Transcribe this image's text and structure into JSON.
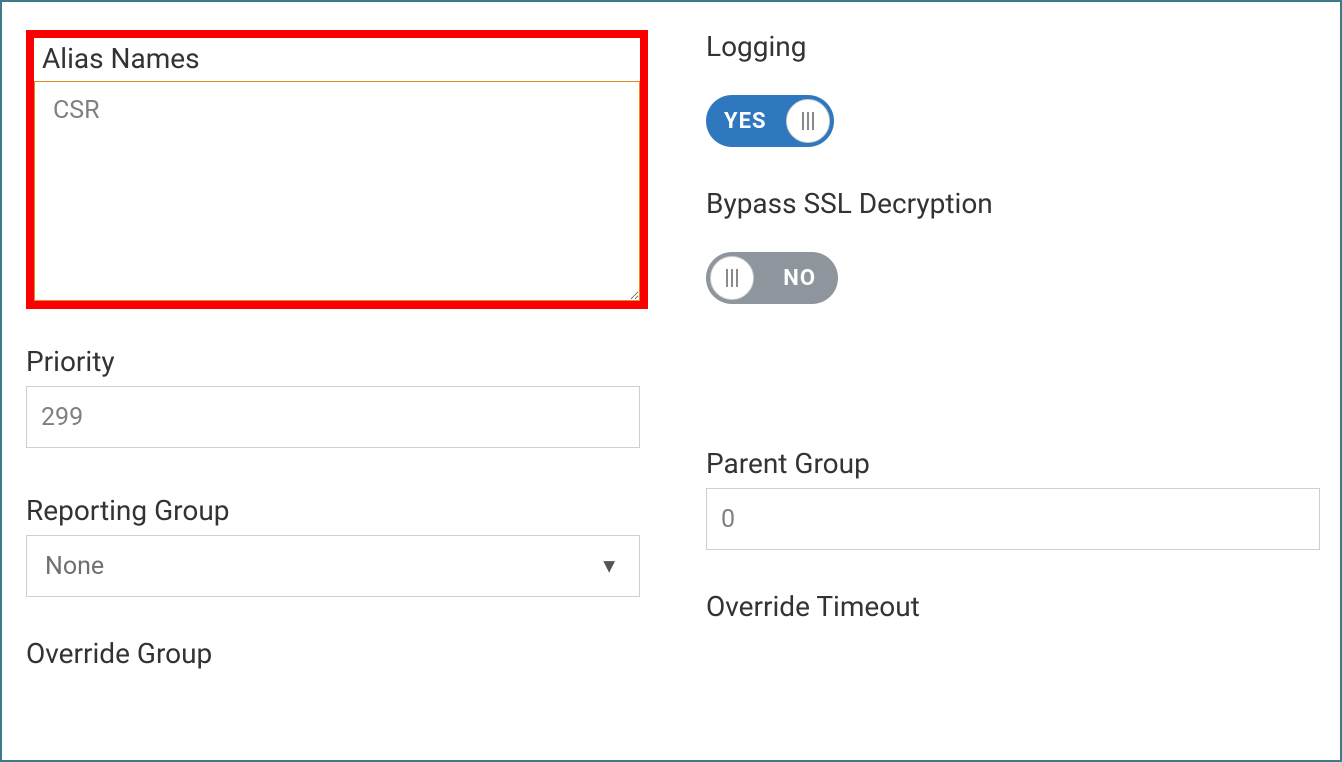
{
  "alias": {
    "label": "Alias Names",
    "placeholder": "CSR",
    "value": ""
  },
  "logging": {
    "label": "Logging",
    "value": "YES",
    "on": true
  },
  "bypass_ssl": {
    "label": "Bypass SSL Decryption",
    "value": "NO",
    "on": false
  },
  "priority": {
    "label": "Priority",
    "value": "299"
  },
  "reporting_group": {
    "label": "Reporting Group",
    "selected": "None"
  },
  "parent_group": {
    "label": "Parent Group",
    "value": "0"
  },
  "override_group": {
    "label": "Override Group"
  },
  "override_timeout": {
    "label": "Override Timeout"
  }
}
